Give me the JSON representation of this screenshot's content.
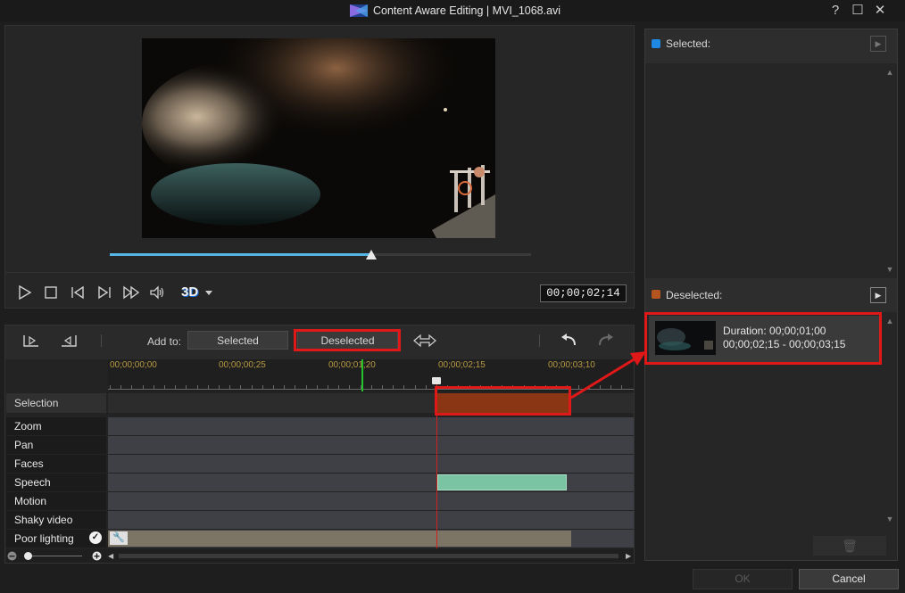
{
  "window": {
    "title": "Content Aware Editing  |  MVI_1068.avi",
    "help_label": "?",
    "maximize_label": "☐",
    "close_label": "✕"
  },
  "player": {
    "timecode": "00;00;02;14",
    "progress": 0.62,
    "badge_3d": "3D"
  },
  "toolbar": {
    "add_to_label": "Add to:",
    "selected_btn": "Selected",
    "deselected_btn": "Deselected"
  },
  "ruler": {
    "timecodes": [
      "00;00;00;00",
      "00;00;00;25",
      "00;00;01;20",
      "00;00;02;15",
      "00;00;03;10"
    ]
  },
  "tracks": {
    "selection": "Selection",
    "rows": [
      "Zoom",
      "Pan",
      "Faces",
      "Speech",
      "Motion",
      "Shaky video",
      "Poor lighting"
    ]
  },
  "right_panel": {
    "selected_title": "Selected:",
    "deselected_title": "Deselected:",
    "clip": {
      "duration": "Duration: 00;00;01;00",
      "range": "00;00;02;15 - 00;00;03;15"
    }
  },
  "dialog": {
    "ok": "OK",
    "cancel": "Cancel"
  },
  "colors": {
    "accent_blue": "#58b6e6",
    "selected_dot": "#1e88e5",
    "deselected_dot": "#b5541e",
    "highlight_red": "#e01818",
    "speech_green": "#7ac3a3"
  }
}
